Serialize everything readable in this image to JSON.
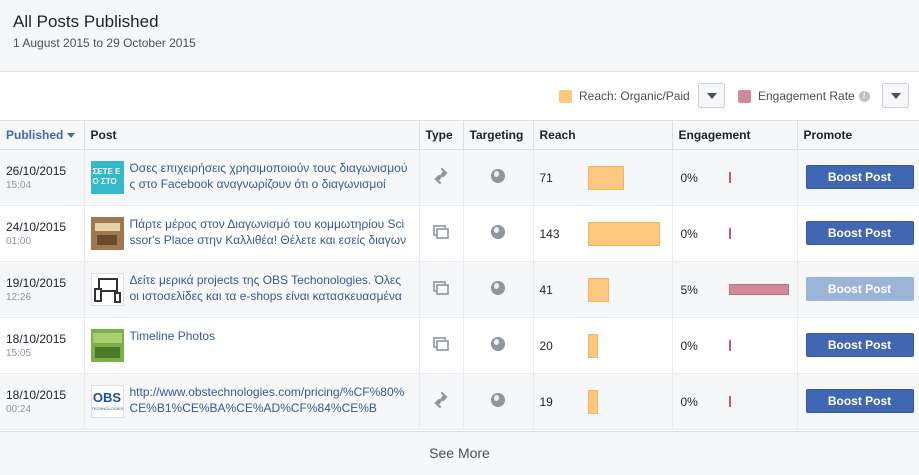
{
  "header": {
    "title": "All Posts Published",
    "date_range": "1 August 2015 to 29 October 2015"
  },
  "legend": {
    "reach_label": "Reach: Organic/Paid",
    "reach_color": "#fcc880",
    "engagement_label": "Engagement Rate",
    "engagement_color": "#d08a9a",
    "info_glyph": "i"
  },
  "columns": {
    "published": "Published",
    "post": "Post",
    "type": "Type",
    "targeting": "Targeting",
    "reach": "Reach",
    "engagement": "Engagement",
    "promote": "Promote"
  },
  "reach_max": 143,
  "posts": [
    {
      "date": "26/10/2015",
      "time": "15:04",
      "text": "Όσες επιχειρήσεις χρησιμοποιούν τους διαγωνισμούς στο Facebook αναγνωρίζουν ότι ο διαγωνισμοί",
      "thumb_icon": "contest-thumbnail",
      "type_icon": "link-icon",
      "targeting_icon": "globe-icon",
      "reach": "71",
      "reach_value": 71,
      "engagement": "0%",
      "engagement_value": 0,
      "button": "Boost Post",
      "button_disabled": false
    },
    {
      "date": "24/10/2015",
      "time": "01:00",
      "text": "Πάρτε μέρος στον Διαγωνισμό του κομμωτηρίου Scissor's Place στην Καλλιθέα! Θέλετε και εσείς διαγων",
      "thumb_icon": "salon-thumbnail",
      "type_icon": "photo-album-icon",
      "targeting_icon": "globe-icon",
      "reach": "143",
      "reach_value": 143,
      "engagement": "0%",
      "engagement_value": 0,
      "button": "Boost Post",
      "button_disabled": false
    },
    {
      "date": "19/10/2015",
      "time": "12:26",
      "text": "Δείτε μερικά projects της OBS Techonologies. Όλες οι ιστοσελίδες και τα e-shops είναι κατασκευασμένα",
      "thumb_icon": "devices-thumbnail",
      "type_icon": "photo-album-icon",
      "targeting_icon": "globe-icon",
      "reach": "41",
      "reach_value": 41,
      "engagement": "5%",
      "engagement_value": 5,
      "button": "Boost Post",
      "button_disabled": true
    },
    {
      "date": "18/10/2015",
      "time": "15:05",
      "text": "Timeline Photos",
      "thumb_icon": "timeline-thumbnail",
      "type_icon": "photo-album-icon",
      "targeting_icon": "globe-icon",
      "reach": "20",
      "reach_value": 20,
      "engagement": "0%",
      "engagement_value": 0,
      "button": "Boost Post",
      "button_disabled": false
    },
    {
      "date": "18/10/2015",
      "time": "00:24",
      "text": "http://www.obstechnologies.com/pricing/%CF%80%CE%B1%CE%BA%CE%AD%CF%84%CE%B",
      "thumb_icon": "obs-logo-thumbnail",
      "type_icon": "link-icon",
      "targeting_icon": "globe-icon",
      "reach": "19",
      "reach_value": 19,
      "engagement": "0%",
      "engagement_value": 0,
      "button": "Boost Post",
      "button_disabled": false
    }
  ],
  "thumb_texts": {
    "contest": "ΣΕΤΕ Ε\nΟ ΣΤΟ",
    "obs": "OBS",
    "obs_sub": "TECHNOLOGIES"
  },
  "see_more": "See More"
}
